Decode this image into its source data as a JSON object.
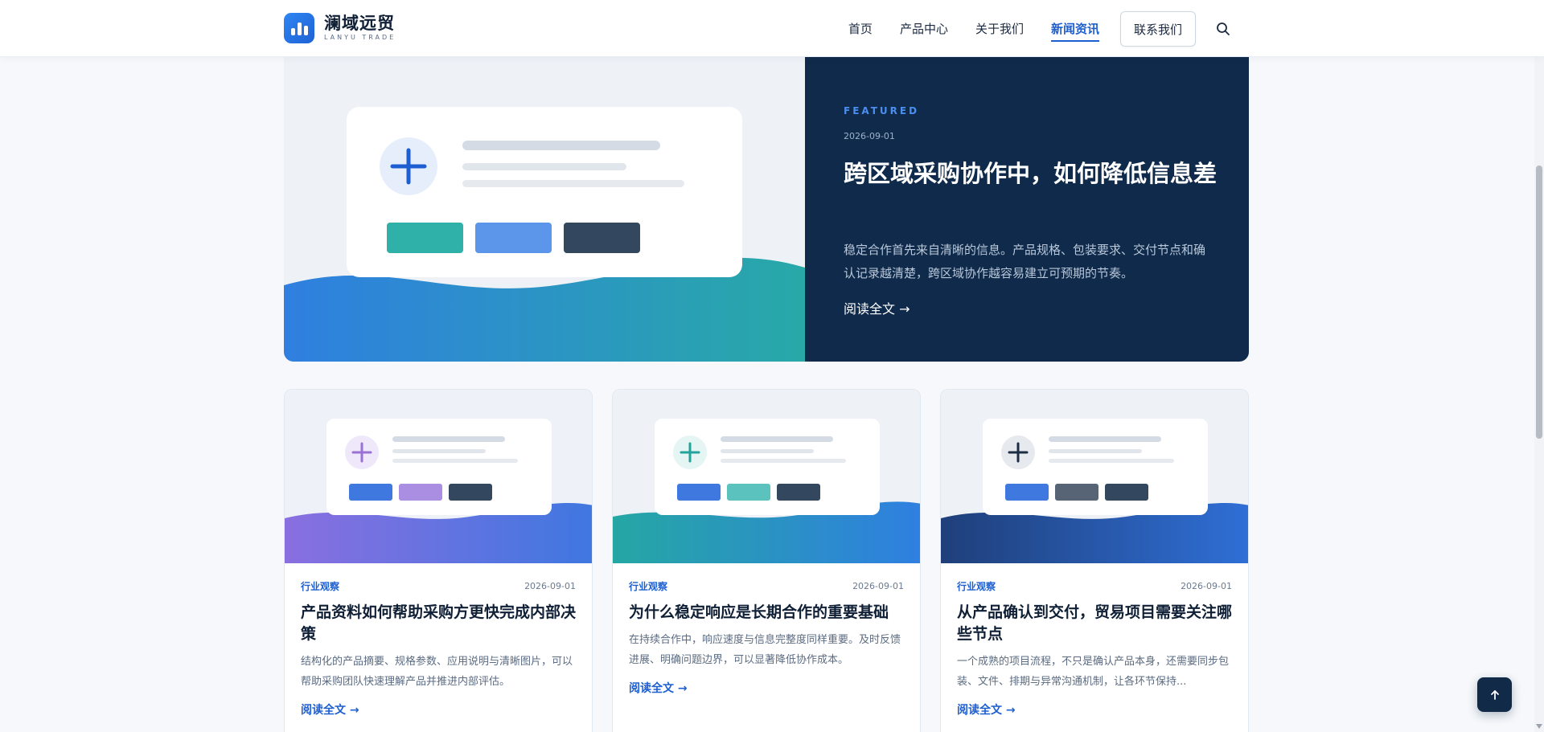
{
  "brand": {
    "name_cn": "澜域远贸",
    "name_en": "LANYU TRADE"
  },
  "nav": {
    "items": [
      {
        "label": "首页",
        "active": false
      },
      {
        "label": "产品中心",
        "active": false
      },
      {
        "label": "关于我们",
        "active": false
      },
      {
        "label": "新闻资讯",
        "active": true
      }
    ],
    "contact_label": "联系我们",
    "search_icon": "search-icon"
  },
  "featured": {
    "kicker": "FEATURED",
    "date": "2026-09-01",
    "title": "跨区域采购协作中，如何降低信息差",
    "excerpt": "稳定合作首先来自清晰的信息。产品规格、包装要求、交付节点和确认记录越清楚，跨区域协作越容易建立可预期的节奏。",
    "read_more": "阅读全文 →",
    "colors": {
      "panel": "#0f2a4a",
      "accent": "#4a8ff0"
    }
  },
  "articles": [
    {
      "category": "行业观察",
      "date": "2026-09-01",
      "title": "产品资料如何帮助采购方更快完成内部决策",
      "excerpt": "结构化的产品摘要、规格参数、应用说明与清晰图片，可以帮助采购团队快速理解产品并推进内部评估。",
      "read_more": "阅读全文 →",
      "icon": "plus-icon"
    },
    {
      "category": "行业观察",
      "date": "2026-09-01",
      "title": "为什么稳定响应是长期合作的重要基础",
      "excerpt": "在持续合作中，响应速度与信息完整度同样重要。及时反馈进展、明确问题边界，可以显著降低协作成本。",
      "read_more": "阅读全文 →",
      "icon": "plus-icon"
    },
    {
      "category": "行业观察",
      "date": "2026-09-01",
      "title": "从产品确认到交付，贸易项目需要关注哪些节点",
      "excerpt": "一个成熟的项目流程，不只是确认产品本身，还需要同步包装、文件、排期与异常沟通机制，让各环节保持...",
      "read_more": "阅读全文 →",
      "icon": "plus-icon"
    }
  ],
  "back_to_top_icon": "arrow-up-icon",
  "colors": {
    "brand_blue": "#1d5fd0",
    "dark_navy": "#102a48"
  }
}
